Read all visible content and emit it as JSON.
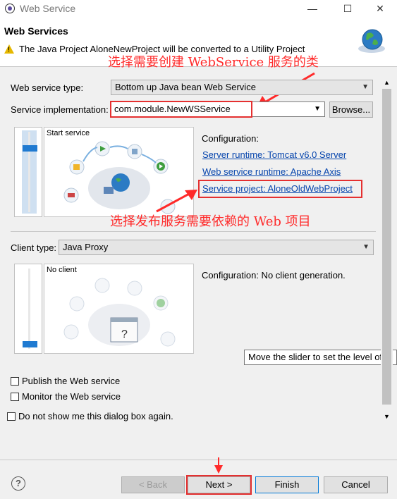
{
  "window": {
    "title": "Web Service",
    "minimize": "—",
    "maximize": "☐",
    "close": "✕"
  },
  "header": {
    "title": "Web Services",
    "message": "The Java Project AloneNewProject will be converted to a Utility Project"
  },
  "annotations": {
    "top_note": "选择需要创建 WebService 服务的类",
    "middle_note": "选择发布服务需要依赖的 Web 项目"
  },
  "service": {
    "type_label": "Web service type:",
    "type_value": "Bottom up Java bean Web Service",
    "impl_label": "Service implementation:",
    "impl_value": "com.module.NewWSService",
    "browse_label": "Browse...",
    "graphic_title": "Start service",
    "config_heading": "Configuration:",
    "server_runtime": "Server runtime: Tomcat v6.0 Server",
    "ws_runtime": "Web service runtime: Apache Axis",
    "service_project": "Service project: AloneOldWebProject",
    "slider_level": 0.17
  },
  "client": {
    "type_label": "Client type:",
    "type_value": "Java Proxy",
    "graphic_title": "No client",
    "config_text": "Configuration: No client generation.",
    "slider_level": 1.0
  },
  "tooltip": "Move the slider to set the level of cli",
  "options": {
    "publish": "Publish the Web service",
    "monitor": "Monitor the Web service",
    "dont_show": "Do not show me this dialog box again."
  },
  "footer": {
    "help": "?",
    "back": "< Back",
    "next": "Next >",
    "finish": "Finish",
    "cancel": "Cancel"
  },
  "colors": {
    "annotation_red": "#ff2a2a",
    "link_blue": "#0645ad",
    "slider_thumb": "#1f7ad1"
  }
}
